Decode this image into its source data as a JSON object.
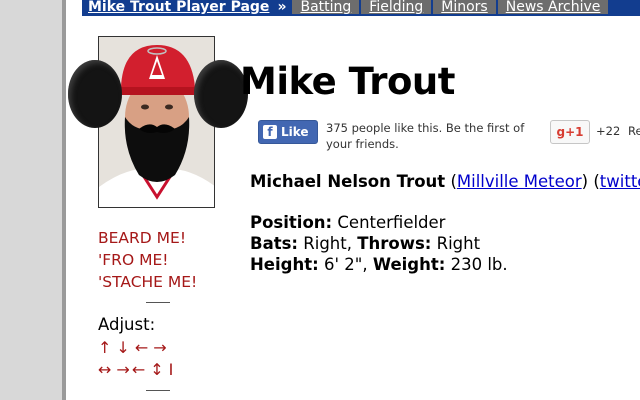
{
  "nav": {
    "title_link": "Mike Trout Player Page",
    "separator": "»",
    "tabs": [
      "Batting",
      "Fielding",
      "Minors",
      "News Archive"
    ]
  },
  "player": {
    "name": "Mike Trout",
    "full_name": "Michael Nelson Trout",
    "nickname_link": "Millville Meteor",
    "twitter_link": "twitter",
    "paren_open": "(",
    "paren_close": ")",
    "position_label": "Position:",
    "position_value": "Centerfielder",
    "bats_label": "Bats:",
    "bats_value": "Right,",
    "throws_label": "Throws:",
    "throws_value": "Right",
    "height_label": "Height:",
    "height_value": "6' 2\",",
    "weight_label": "Weight:",
    "weight_value": "230 lb."
  },
  "social": {
    "fb_like_label": "Like",
    "fb_like_text": "375 people like this. Be the first of your friends.",
    "gplus_label": "+1",
    "gplus_count": "+22",
    "gplus_rec": "Re"
  },
  "controls": {
    "beard": "BEARD ME!",
    "fro": "'FRO ME!",
    "stache": "'STACHE ME!",
    "adjust_label": "Adjust:",
    "arrows_row1": [
      "↑",
      "↓",
      "←",
      "→"
    ],
    "arrows_row2": [
      "↔",
      "→←",
      "↕",
      "I"
    ]
  },
  "colors": {
    "nav_bg": "#123d8f",
    "tab_bg": "#6d6d6d",
    "control_red": "#a51818",
    "link_blue": "#0000cc",
    "fb_blue": "#4267b2"
  }
}
